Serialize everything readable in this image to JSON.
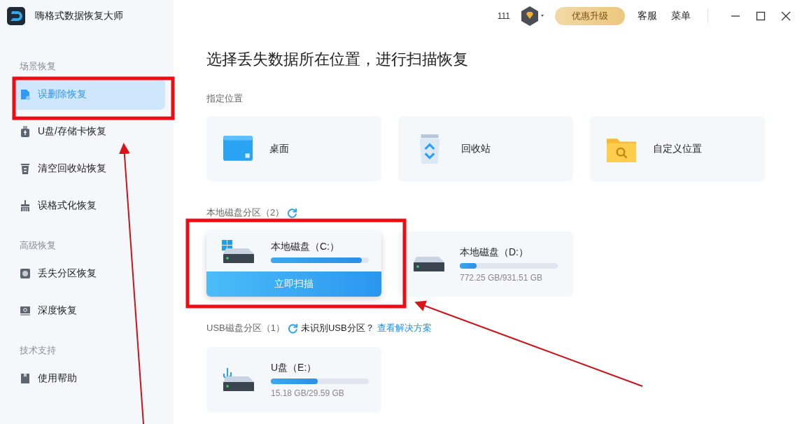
{
  "app": {
    "title": "嗨格式数据恢复大师"
  },
  "header": {
    "count": "111",
    "upgrade": "优惠升级",
    "links": [
      "客服",
      "菜单"
    ]
  },
  "sidebar": {
    "groups": [
      {
        "label": "场景恢复",
        "items": [
          {
            "label": "误删除恢复",
            "selected": true
          },
          {
            "label": "U盘/存储卡恢复",
            "selected": false
          },
          {
            "label": "清空回收站恢复",
            "selected": false
          },
          {
            "label": "误格式化恢复",
            "selected": false
          }
        ]
      },
      {
        "label": "高级恢复",
        "items": [
          {
            "label": "丢失分区恢复",
            "selected": false
          },
          {
            "label": "深度恢复",
            "selected": false
          }
        ]
      },
      {
        "label": "技术支持",
        "items": [
          {
            "label": "使用帮助",
            "selected": false
          }
        ]
      }
    ]
  },
  "main": {
    "heading": "选择丢失数据所在位置，进行扫描恢复",
    "locations": {
      "label": "指定位置",
      "items": [
        {
          "label": "桌面"
        },
        {
          "label": "回收站"
        },
        {
          "label": "自定义位置"
        }
      ]
    },
    "local_disks": {
      "label": "本地磁盘分区（2）",
      "items": [
        {
          "name": "本地磁盘（C:）",
          "level": 0.93,
          "action": "立即扫描"
        },
        {
          "name": "本地磁盘（D:）",
          "level": 0.17,
          "usage": "772.25 GB/931.51 GB"
        }
      ]
    },
    "usb_disks": {
      "label": "USB磁盘分区（1）",
      "hint": "未识别USB分区？",
      "link": "查看解决方案",
      "items": [
        {
          "name": "U盘（E:）",
          "level": 0.48,
          "usage": "15.18 GB/29.59 GB"
        }
      ]
    }
  }
}
